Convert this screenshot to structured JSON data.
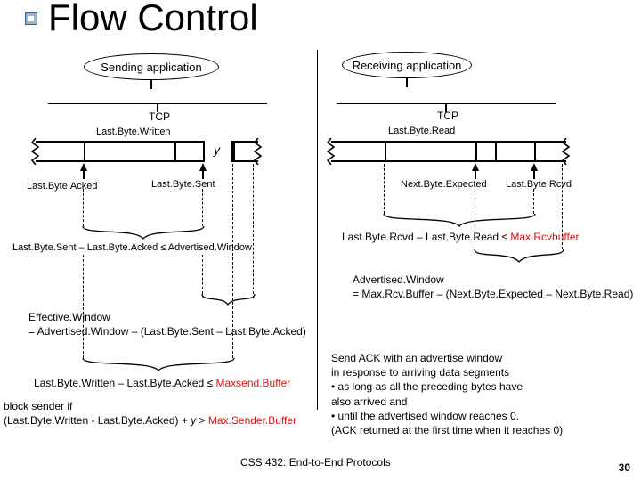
{
  "title": "Flow Control",
  "sender_app": "Sending application",
  "receiver_app": "Receiving application",
  "tcp_label": "TCP",
  "lb_written": "Last.Byte.Written",
  "lb_read": "Last.Byte.Read",
  "y_label": "y",
  "lb_acked": "Last.Byte.Acked",
  "lb_sent": "Last.Byte.Sent",
  "nb_expected": "Next.Byte.Expected",
  "lb_rcvd": "Last.Byte.Rcvd",
  "left_ineq_a": "Last.Byte.Sent – Last.Byte.Acked ≤ Advertised.Window",
  "right_ineq_pre": "Last.Byte.Rcvd – Last.Byte.Read ≤ ",
  "right_ineq_red": "Max.Rcvbuffer",
  "adv_window_line1": "Advertised.Window",
  "adv_window_line2": "= Max.Rcv.Buffer – (Next.Byte.Expected – Next.Byte.Read)",
  "eff_window_line1": "Effective.Window",
  "eff_window_line2": "= Advertised.Window – (Last.Byte.Sent – Last.Byte.Acked)",
  "left_ineq_b_pre": "Last.Byte.Written – Last.Byte.Acked ≤  ",
  "left_ineq_b_red": "Maxsend.Buffer",
  "block_line1": "block sender if",
  "block_line2_pre": "(Last.Byte.Written - Last.Byte.Acked) + ",
  "block_line2_y": "y",
  "block_line2_post": " > ",
  "block_line2_red": "Max.Sender.Buffer",
  "ack_para": "Send ACK with an advertise window\nin response to arriving data segments\n• as long as all the preceding bytes have\n   also arrived and\n• until the advertised window reaches 0.\n   (ACK returned at the first time when it reaches 0)",
  "footer": "CSS 432: End-to-End Protocols",
  "page": "30"
}
